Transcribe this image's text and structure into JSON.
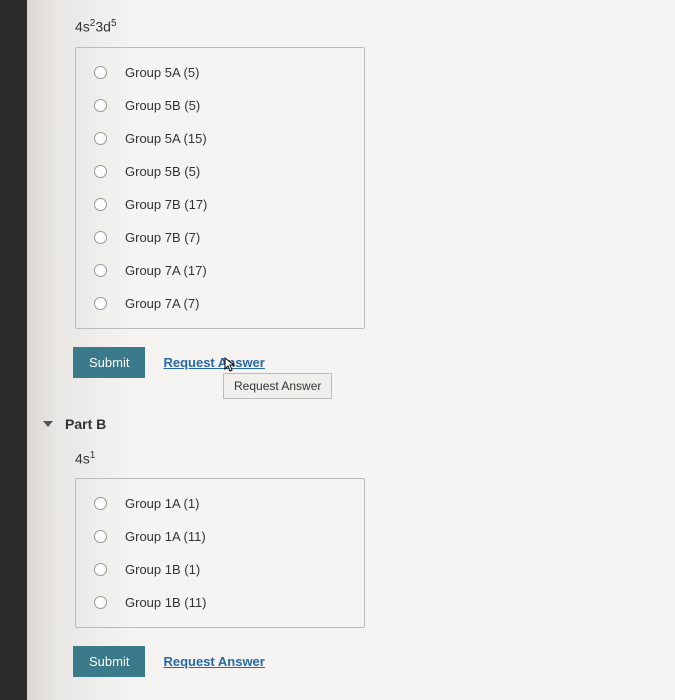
{
  "partA": {
    "question": {
      "base1": "4s",
      "exp1": "2",
      "base2": "3d",
      "exp2": "5"
    },
    "options": [
      "Group 5A (5)",
      "Group 5B (5)",
      "Group 5A (15)",
      "Group 5B (5)",
      "Group 7B (17)",
      "Group 7B (7)",
      "Group 7A (17)",
      "Group 7A (7)"
    ],
    "submit": "Submit",
    "requestAnswer": "Request Answer",
    "tooltip": "Request Answer"
  },
  "partB": {
    "title": "Part B",
    "question": {
      "base1": "4s",
      "exp1": "1"
    },
    "options": [
      "Group 1A (1)",
      "Group 1A (11)",
      "Group 1B (1)",
      "Group 1B (11)"
    ],
    "submit": "Submit",
    "requestAnswer": "Request Answer"
  }
}
